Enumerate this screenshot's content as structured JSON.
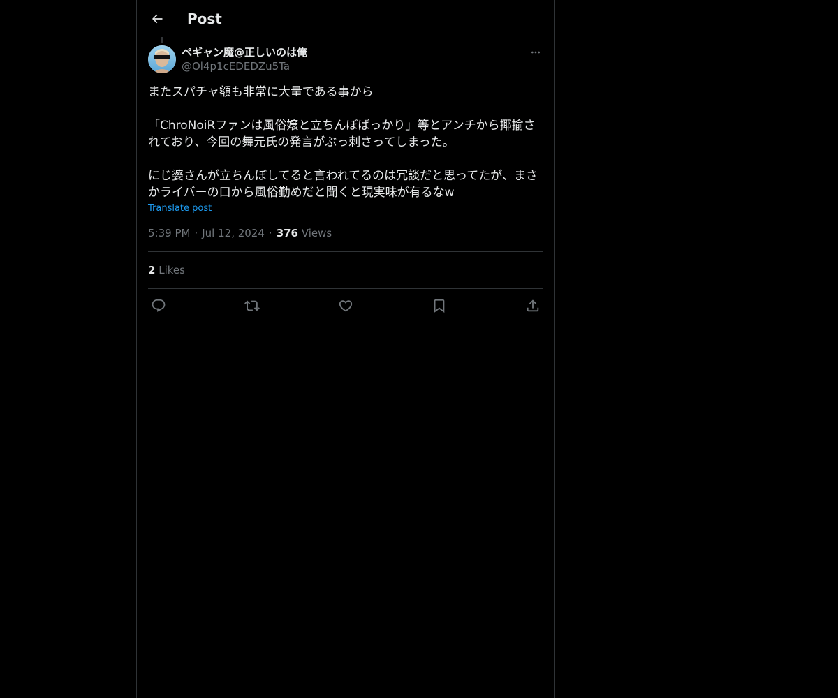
{
  "header": {
    "title": "Post",
    "back_icon": "arrow-left-icon"
  },
  "post": {
    "author": {
      "display_name": "ペギャン魔@正しいのは俺",
      "handle": "@Ol4p1cEDEDZu5Ta",
      "avatar_icon": "avatar-photo"
    },
    "paragraphs": [
      "またスパチャ額も非常に大量である事から",
      "「ChroNoiRファンは風俗嬢と立ちんぼばっかり」等とアンチから揶揄されており、今回の舞元氏の発言がぶっ刺さってしまった。",
      "にじ婆さんが立ちんぼしてると言われてるのは冗談だと思ってたが、まさかライバーの口から風俗勤めだと聞くと現実味が有るなw"
    ],
    "translate_label": "Translate post",
    "time": "5:39 PM",
    "date": "Jul 12, 2024",
    "views_count": "376",
    "views_label": "Views",
    "likes_count": "2",
    "likes_label": "Likes"
  },
  "actions": [
    {
      "name": "reply",
      "icon": "reply-icon"
    },
    {
      "name": "repost",
      "icon": "repost-icon"
    },
    {
      "name": "like",
      "icon": "heart-icon"
    },
    {
      "name": "bookmark",
      "icon": "bookmark-icon"
    },
    {
      "name": "share",
      "icon": "share-icon"
    }
  ],
  "colors": {
    "background": "#000000",
    "text": "#e7e9ea",
    "secondary_text": "#71767b",
    "link": "#1d9bf0",
    "border": "#2f3336"
  }
}
